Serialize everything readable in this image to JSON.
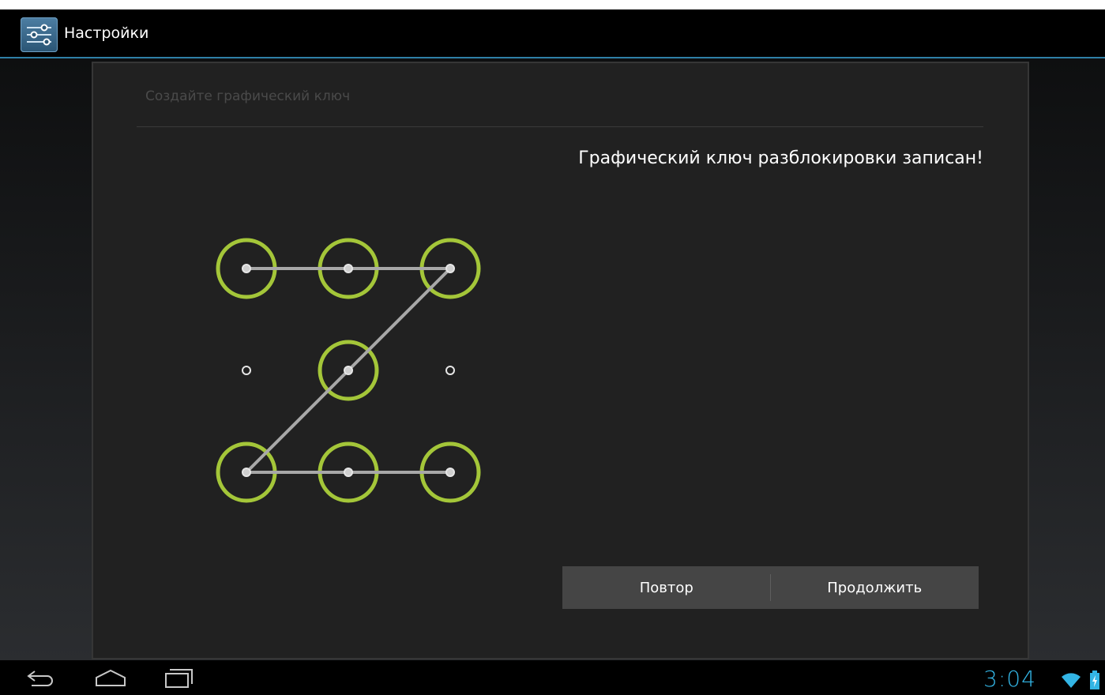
{
  "action_bar": {
    "title": "Настройки",
    "icon": "settings-sliders-icon"
  },
  "dialog": {
    "title": "Создайте графический ключ",
    "status_message": "Графический ключ разблокировки записан!",
    "pattern": {
      "grid": "3x3",
      "selected_sequence": [
        1,
        2,
        3,
        5,
        7,
        8,
        9
      ],
      "unselected_dots": [
        4,
        6
      ]
    },
    "buttons": {
      "retry_label": "Повтор",
      "continue_label": "Продолжить"
    }
  },
  "nav_bar": {
    "back_icon": "back-icon",
    "home_icon": "home-icon",
    "recents_icon": "recents-icon"
  },
  "status": {
    "time": "3:04",
    "wifi_icon": "wifi-icon",
    "battery_icon": "battery-charging-icon"
  },
  "colors": {
    "accent": "#33b5e5",
    "pattern_ring": "#a4c639",
    "pattern_line": "#a8a8a8"
  }
}
